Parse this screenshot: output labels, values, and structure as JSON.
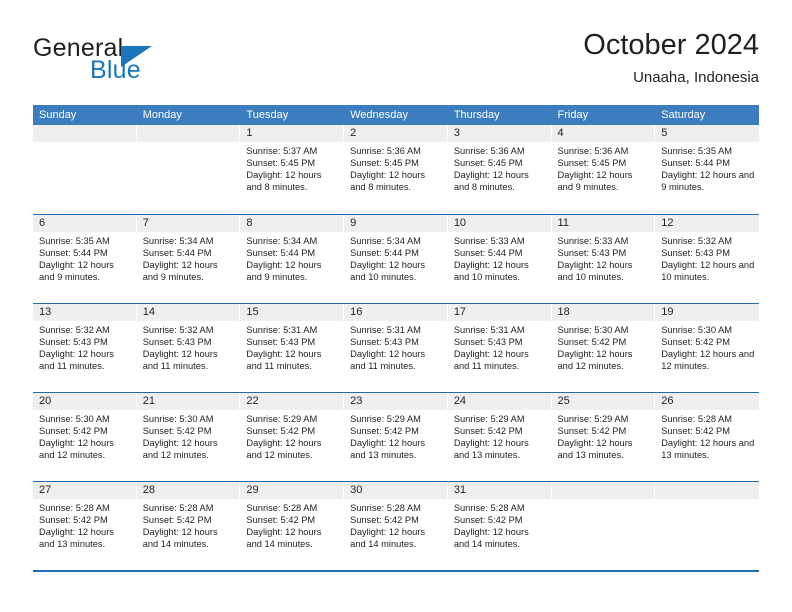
{
  "brand": {
    "name_part1": "General",
    "name_part2": "Blue",
    "flag_icon": "triangle-flag-icon",
    "accent_color": "#1b75bb"
  },
  "header": {
    "title": "October 2024",
    "subtitle": "Unaaha, Indonesia"
  },
  "calendar": {
    "header_bg": "#3c7dbf",
    "row_divider_color": "#1f6cb0",
    "day_strip_bg": "#efefef",
    "weekdays": [
      "Sunday",
      "Monday",
      "Tuesday",
      "Wednesday",
      "Thursday",
      "Friday",
      "Saturday"
    ],
    "weeks": [
      [
        {
          "date": "",
          "empty": true
        },
        {
          "date": "",
          "empty": true
        },
        {
          "date": "1",
          "sunrise": "Sunrise: 5:37 AM",
          "sunset": "Sunset: 5:45 PM",
          "daylight": "Daylight: 12 hours and 8 minutes."
        },
        {
          "date": "2",
          "sunrise": "Sunrise: 5:36 AM",
          "sunset": "Sunset: 5:45 PM",
          "daylight": "Daylight: 12 hours and 8 minutes."
        },
        {
          "date": "3",
          "sunrise": "Sunrise: 5:36 AM",
          "sunset": "Sunset: 5:45 PM",
          "daylight": "Daylight: 12 hours and 8 minutes."
        },
        {
          "date": "4",
          "sunrise": "Sunrise: 5:36 AM",
          "sunset": "Sunset: 5:45 PM",
          "daylight": "Daylight: 12 hours and 9 minutes."
        },
        {
          "date": "5",
          "sunrise": "Sunrise: 5:35 AM",
          "sunset": "Sunset: 5:44 PM",
          "daylight": "Daylight: 12 hours and 9 minutes."
        }
      ],
      [
        {
          "date": "6",
          "sunrise": "Sunrise: 5:35 AM",
          "sunset": "Sunset: 5:44 PM",
          "daylight": "Daylight: 12 hours and 9 minutes."
        },
        {
          "date": "7",
          "sunrise": "Sunrise: 5:34 AM",
          "sunset": "Sunset: 5:44 PM",
          "daylight": "Daylight: 12 hours and 9 minutes."
        },
        {
          "date": "8",
          "sunrise": "Sunrise: 5:34 AM",
          "sunset": "Sunset: 5:44 PM",
          "daylight": "Daylight: 12 hours and 9 minutes."
        },
        {
          "date": "9",
          "sunrise": "Sunrise: 5:34 AM",
          "sunset": "Sunset: 5:44 PM",
          "daylight": "Daylight: 12 hours and 10 minutes."
        },
        {
          "date": "10",
          "sunrise": "Sunrise: 5:33 AM",
          "sunset": "Sunset: 5:44 PM",
          "daylight": "Daylight: 12 hours and 10 minutes."
        },
        {
          "date": "11",
          "sunrise": "Sunrise: 5:33 AM",
          "sunset": "Sunset: 5:43 PM",
          "daylight": "Daylight: 12 hours and 10 minutes."
        },
        {
          "date": "12",
          "sunrise": "Sunrise: 5:32 AM",
          "sunset": "Sunset: 5:43 PM",
          "daylight": "Daylight: 12 hours and 10 minutes."
        }
      ],
      [
        {
          "date": "13",
          "sunrise": "Sunrise: 5:32 AM",
          "sunset": "Sunset: 5:43 PM",
          "daylight": "Daylight: 12 hours and 11 minutes."
        },
        {
          "date": "14",
          "sunrise": "Sunrise: 5:32 AM",
          "sunset": "Sunset: 5:43 PM",
          "daylight": "Daylight: 12 hours and 11 minutes."
        },
        {
          "date": "15",
          "sunrise": "Sunrise: 5:31 AM",
          "sunset": "Sunset: 5:43 PM",
          "daylight": "Daylight: 12 hours and 11 minutes."
        },
        {
          "date": "16",
          "sunrise": "Sunrise: 5:31 AM",
          "sunset": "Sunset: 5:43 PM",
          "daylight": "Daylight: 12 hours and 11 minutes."
        },
        {
          "date": "17",
          "sunrise": "Sunrise: 5:31 AM",
          "sunset": "Sunset: 5:43 PM",
          "daylight": "Daylight: 12 hours and 11 minutes."
        },
        {
          "date": "18",
          "sunrise": "Sunrise: 5:30 AM",
          "sunset": "Sunset: 5:42 PM",
          "daylight": "Daylight: 12 hours and 12 minutes."
        },
        {
          "date": "19",
          "sunrise": "Sunrise: 5:30 AM",
          "sunset": "Sunset: 5:42 PM",
          "daylight": "Daylight: 12 hours and 12 minutes."
        }
      ],
      [
        {
          "date": "20",
          "sunrise": "Sunrise: 5:30 AM",
          "sunset": "Sunset: 5:42 PM",
          "daylight": "Daylight: 12 hours and 12 minutes."
        },
        {
          "date": "21",
          "sunrise": "Sunrise: 5:30 AM",
          "sunset": "Sunset: 5:42 PM",
          "daylight": "Daylight: 12 hours and 12 minutes."
        },
        {
          "date": "22",
          "sunrise": "Sunrise: 5:29 AM",
          "sunset": "Sunset: 5:42 PM",
          "daylight": "Daylight: 12 hours and 12 minutes."
        },
        {
          "date": "23",
          "sunrise": "Sunrise: 5:29 AM",
          "sunset": "Sunset: 5:42 PM",
          "daylight": "Daylight: 12 hours and 13 minutes."
        },
        {
          "date": "24",
          "sunrise": "Sunrise: 5:29 AM",
          "sunset": "Sunset: 5:42 PM",
          "daylight": "Daylight: 12 hours and 13 minutes."
        },
        {
          "date": "25",
          "sunrise": "Sunrise: 5:29 AM",
          "sunset": "Sunset: 5:42 PM",
          "daylight": "Daylight: 12 hours and 13 minutes."
        },
        {
          "date": "26",
          "sunrise": "Sunrise: 5:28 AM",
          "sunset": "Sunset: 5:42 PM",
          "daylight": "Daylight: 12 hours and 13 minutes."
        }
      ],
      [
        {
          "date": "27",
          "sunrise": "Sunrise: 5:28 AM",
          "sunset": "Sunset: 5:42 PM",
          "daylight": "Daylight: 12 hours and 13 minutes."
        },
        {
          "date": "28",
          "sunrise": "Sunrise: 5:28 AM",
          "sunset": "Sunset: 5:42 PM",
          "daylight": "Daylight: 12 hours and 14 minutes."
        },
        {
          "date": "29",
          "sunrise": "Sunrise: 5:28 AM",
          "sunset": "Sunset: 5:42 PM",
          "daylight": "Daylight: 12 hours and 14 minutes."
        },
        {
          "date": "30",
          "sunrise": "Sunrise: 5:28 AM",
          "sunset": "Sunset: 5:42 PM",
          "daylight": "Daylight: 12 hours and 14 minutes."
        },
        {
          "date": "31",
          "sunrise": "Sunrise: 5:28 AM",
          "sunset": "Sunset: 5:42 PM",
          "daylight": "Daylight: 12 hours and 14 minutes."
        },
        {
          "date": "",
          "empty": true
        },
        {
          "date": "",
          "empty": true
        }
      ]
    ]
  }
}
